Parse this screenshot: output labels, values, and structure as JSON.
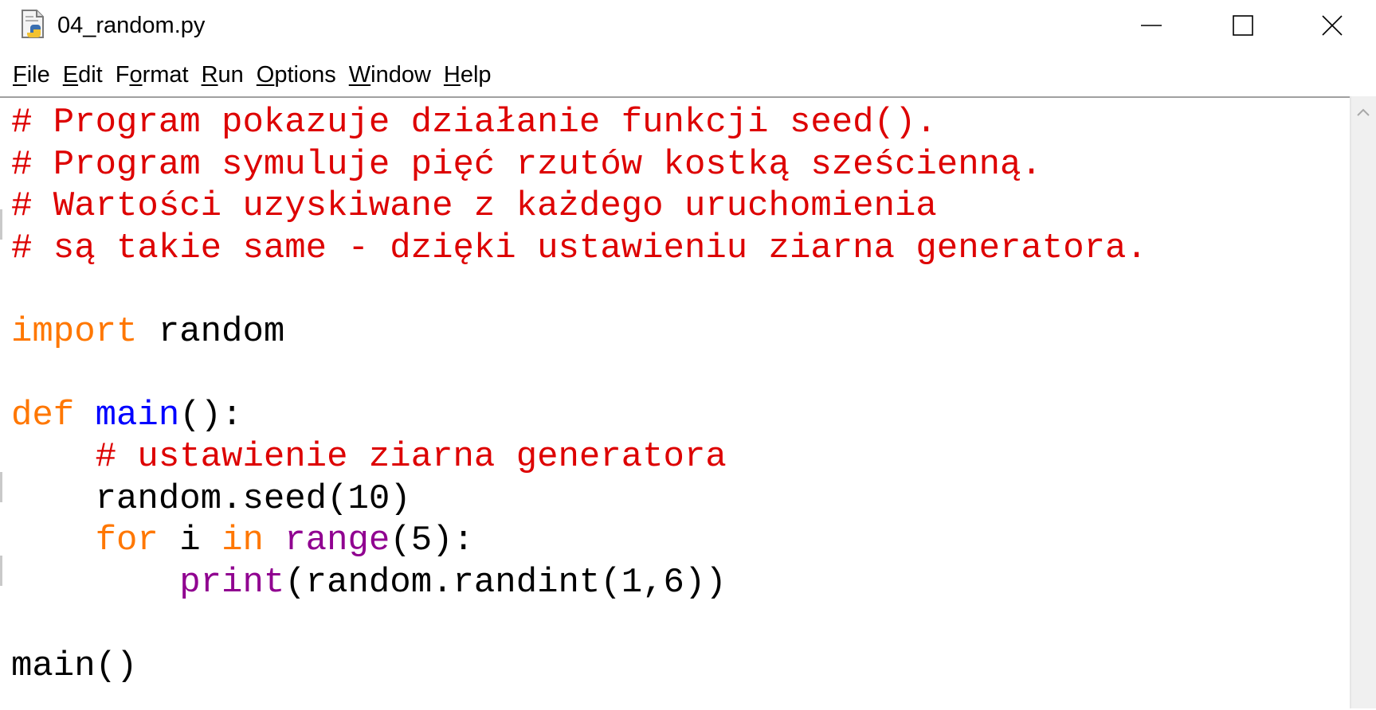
{
  "window": {
    "title": "04_random.py",
    "icons": {
      "app": "python-file-icon",
      "minimize": "minimize-icon",
      "maximize": "maximize-icon",
      "close": "close-icon"
    }
  },
  "menu": [
    {
      "underline": "F",
      "rest": "ile"
    },
    {
      "underline": "E",
      "rest": "dit"
    },
    {
      "pre": "F",
      "underline": "o",
      "rest": "rmat"
    },
    {
      "underline": "R",
      "rest": "un"
    },
    {
      "underline": "O",
      "rest": "ptions"
    },
    {
      "underline": "W",
      "rest": "indow"
    },
    {
      "underline": "H",
      "rest": "elp"
    }
  ],
  "colors": {
    "comment": "#dd0000",
    "keyword": "#ff7700",
    "definition": "#0000ff",
    "builtin": "#900090",
    "text": "#000000"
  },
  "code": {
    "lines": [
      [
        {
          "t": "# Program pokazuje działanie funkcji seed().",
          "c": "cmt"
        }
      ],
      [
        {
          "t": "# Program symuluje pięć rzutów kostką sześcienną.",
          "c": "cmt"
        }
      ],
      [
        {
          "t": "# Wartości uzyskiwane z każdego uruchomienia",
          "c": "cmt"
        }
      ],
      [
        {
          "t": "# są takie same - dzięki ustawieniu ziarna generatora.",
          "c": "cmt"
        }
      ],
      [],
      [
        {
          "t": "import",
          "c": "kw"
        },
        {
          "t": " random",
          "c": ""
        }
      ],
      [],
      [
        {
          "t": "def",
          "c": "kw"
        },
        {
          "t": " ",
          "c": ""
        },
        {
          "t": "main",
          "c": "fn"
        },
        {
          "t": "():",
          "c": ""
        }
      ],
      [
        {
          "t": "    ",
          "c": ""
        },
        {
          "t": "# ustawienie ziarna generatora",
          "c": "cmt"
        }
      ],
      [
        {
          "t": "    random.seed(10)",
          "c": ""
        }
      ],
      [
        {
          "t": "    ",
          "c": ""
        },
        {
          "t": "for",
          "c": "kw"
        },
        {
          "t": " i ",
          "c": ""
        },
        {
          "t": "in",
          "c": "kw"
        },
        {
          "t": " ",
          "c": ""
        },
        {
          "t": "range",
          "c": "bi"
        },
        {
          "t": "(5):",
          "c": ""
        }
      ],
      [
        {
          "t": "        ",
          "c": ""
        },
        {
          "t": "print",
          "c": "bi"
        },
        {
          "t": "(random.randint(1,6))",
          "c": ""
        }
      ],
      [],
      [
        {
          "t": "main()",
          "c": ""
        }
      ]
    ]
  }
}
